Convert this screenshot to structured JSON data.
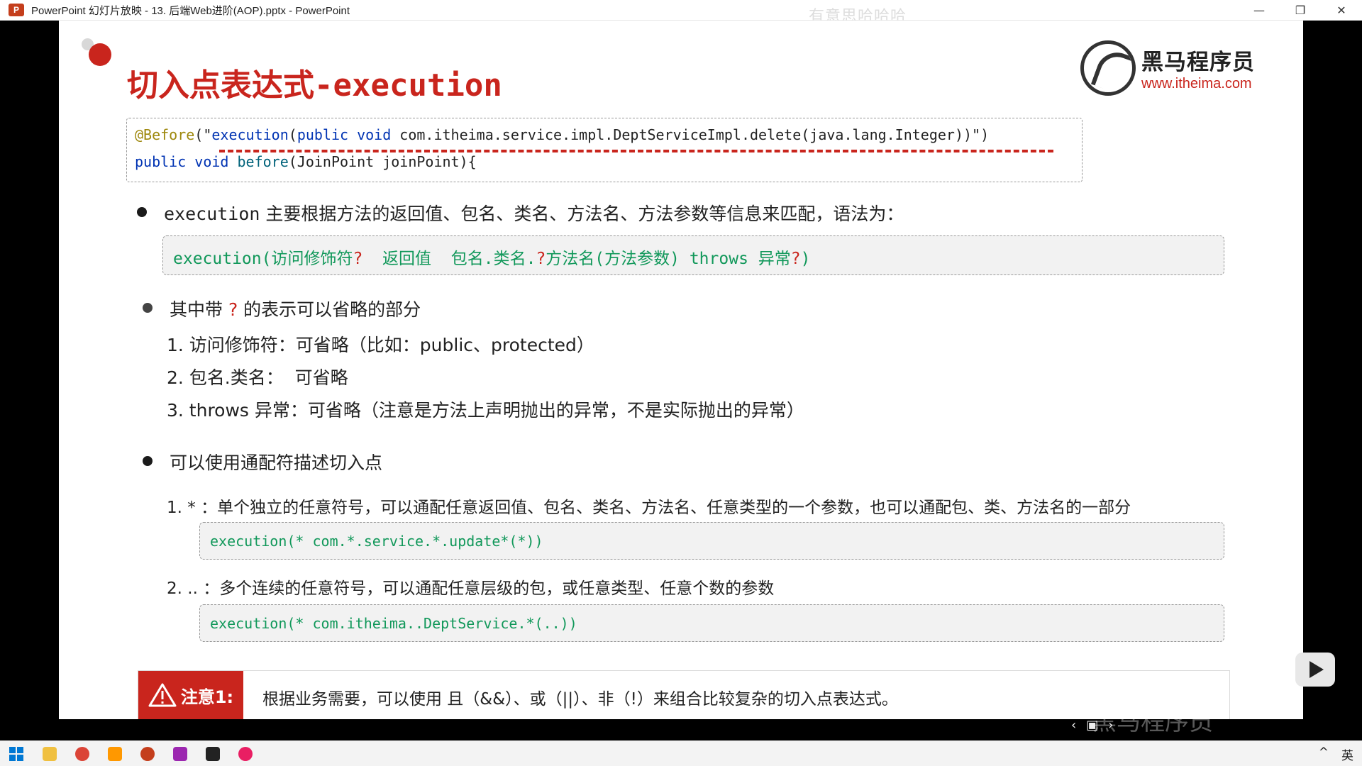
{
  "window": {
    "title": "PowerPoint 幻灯片放映  -  13. 后端Web进阶(AOP).pptx - PowerPoint",
    "app_icon": "P",
    "watermark": "有意思哈哈哈",
    "buttons": {
      "minimize": "—",
      "restore": "❐",
      "close": "✕"
    }
  },
  "slide": {
    "title": "切入点表达式-execution",
    "logo": {
      "name": "黑马程序员",
      "url": "www.itheima.com"
    },
    "code": {
      "line1": {
        "anno": "@Before",
        "p1": "(\"",
        "kw1": "execution",
        "p2": "(",
        "kw2": "public void",
        "rest": " com.itheima.service.impl.DeptServiceImpl.delete(java.lang.Integer))\")"
      },
      "line2": {
        "kw": "public void",
        "fn": " before",
        "rest": "(JoinPoint joinPoint){"
      }
    },
    "bullet1": {
      "prefix": "execution",
      "text": " 主要根据方法的返回值、包名、类名、方法名、方法参数等信息来匹配，语法为："
    },
    "syntax": {
      "s1": "execution(访问修饰符",
      "q1": "?",
      "s2": "  返回值  包名.类名.",
      "q2": "?",
      "s3": "方法名(方法参数) throws 异常",
      "q3": "?",
      "s4": ")"
    },
    "bullet2": {
      "a": "其中带 ",
      "q": "?",
      "b": " 的表示可以省略的部分"
    },
    "omit": [
      "1. 访问修饰符：可省略（比如：public、protected）",
      "2. 包名.类名：  可省略",
      "3. throws 异常：可省略（注意是方法上声明抛出的异常，不是实际抛出的异常）"
    ],
    "bullet3": "可以使用通配符描述切入点",
    "wild1": "1. * ：单个独立的任意符号，可以通配任意返回值、包名、类名、方法名、任意类型的一个参数，也可以通配包、类、方法名的一部分",
    "ex1": "execution(* com.*.service.*.update*(*))",
    "wild2": "2. .. ：多个连续的任意符号，可以通配任意层级的包，或任意类型、任意个数的参数",
    "ex2": "execution(* com.itheima..DeptService.*(..))",
    "note": {
      "label": "注意1:",
      "text": "根据业务需要，可以使用 且（&&）、或（||）、非（!）来组合比较复杂的切入点表达式。"
    }
  },
  "overlay": {
    "watermark": "黑马程序员",
    "nav": [
      "‹",
      "▣",
      "›"
    ]
  },
  "taskbar": {
    "tray_lang": "英",
    "tray_up": "^"
  },
  "colors": {
    "accent": "#c9251d",
    "code_green": "#11985a",
    "keyword": "#0033b3"
  }
}
